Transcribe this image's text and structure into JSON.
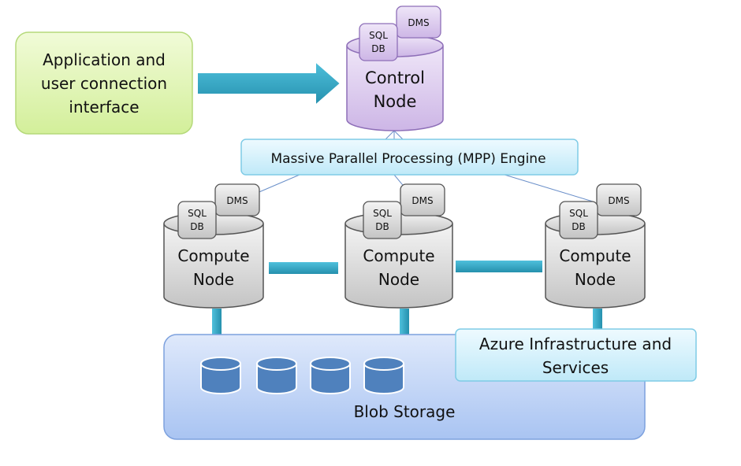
{
  "app_box": {
    "lines": [
      "Application and",
      "user connection",
      "interface"
    ]
  },
  "control_node": {
    "lines": [
      "Control",
      "Node"
    ],
    "sql": [
      "SQL",
      "DB"
    ],
    "dms": "DMS"
  },
  "mpp": "Massive Parallel Processing (MPP)  Engine",
  "compute_nodes": [
    {
      "lines": [
        "Compute",
        "Node"
      ],
      "sql": [
        "SQL",
        "DB"
      ],
      "dms": "DMS"
    },
    {
      "lines": [
        "Compute",
        "Node"
      ],
      "sql": [
        "SQL",
        "DB"
      ],
      "dms": "DMS"
    },
    {
      "lines": [
        "Compute",
        "Node"
      ],
      "sql": [
        "SQL",
        "DB"
      ],
      "dms": "DMS"
    }
  ],
  "blob": "Blob Storage",
  "azure": {
    "lines": [
      "Azure Infrastructure and",
      "Services"
    ]
  },
  "colors": {
    "connector": "#3aa9c6",
    "purple": "#d9c8ec",
    "gray": "#d6d6d6",
    "blob_fill": "#c6d9f7",
    "disk": "#4f81bd",
    "green": "#e2f5b8",
    "cyan": "#d4f1fb"
  }
}
